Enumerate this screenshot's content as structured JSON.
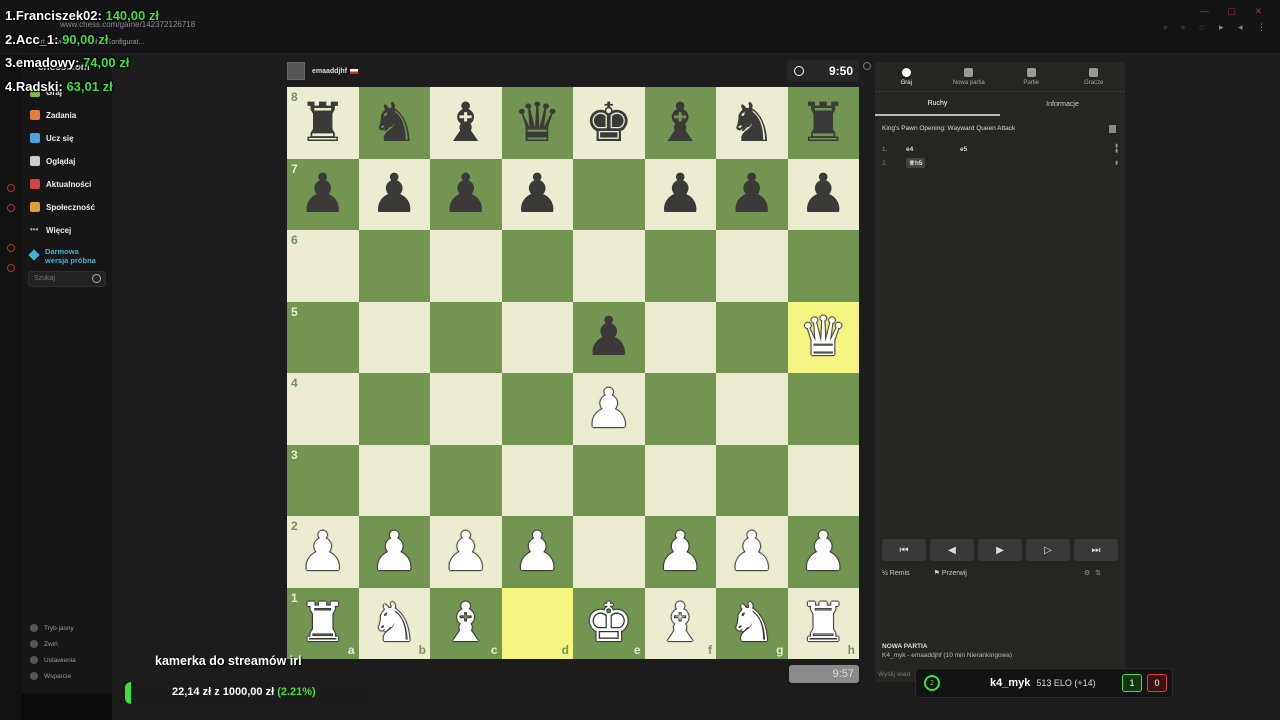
{
  "browser": {
    "url": "www.chess.com/game/142372126718",
    "bookmarks": [
      "Start - Twitch",
      "Tipply | Konfigurat..."
    ]
  },
  "sidebar": {
    "logo": "chess.com",
    "items": [
      {
        "label": "Graj",
        "icon": "pawn-icon",
        "color": "#81b64c"
      },
      {
        "label": "Zadania",
        "icon": "puzzle-icon",
        "color": "#e77c3a"
      },
      {
        "label": "Ucz się",
        "icon": "learn-icon",
        "color": "#4aa3df"
      },
      {
        "label": "Oglądaj",
        "icon": "binoculars-icon",
        "color": "#cccccc"
      },
      {
        "label": "Aktualności",
        "icon": "news-icon",
        "color": "#d04545"
      },
      {
        "label": "Społeczność",
        "icon": "community-icon",
        "color": "#e0a030"
      },
      {
        "label": "Więcej",
        "icon": "more-icon",
        "color": "#aaaaaa"
      }
    ],
    "trial_line1": "Darmowa",
    "trial_line2": "wersja próbna",
    "search_placeholder": "Szukaj",
    "bottom": [
      "Tryb jasny",
      "Zwiń",
      "Ustawienia",
      "Wsparcie"
    ]
  },
  "top_player": {
    "name": "emaaddjhf"
  },
  "clock_top": "9:50",
  "clock_bottom": "9:57",
  "board": {
    "ranks": [
      "8",
      "7",
      "6",
      "5",
      "4",
      "3",
      "2",
      "1"
    ],
    "files": [
      "a",
      "b",
      "c",
      "d",
      "e",
      "f",
      "g",
      "h"
    ],
    "position": [
      [
        "br",
        "bn",
        "bb",
        "bq",
        "bk",
        "bb",
        "bn",
        "br"
      ],
      [
        "bp",
        "bp",
        "bp",
        "bp",
        "",
        "bp",
        "bp",
        "bp"
      ],
      [
        "",
        "",
        "",
        "",
        "",
        "",
        "",
        ""
      ],
      [
        "",
        "",
        "",
        "",
        "bp",
        "",
        "",
        "wq"
      ],
      [
        "",
        "",
        "",
        "",
        "wp",
        "",
        "",
        ""
      ],
      [
        "",
        "",
        "",
        "",
        "",
        "",
        "",
        ""
      ],
      [
        "wp",
        "wp",
        "wp",
        "wp",
        "",
        "wp",
        "wp",
        "wp"
      ],
      [
        "wr",
        "wn",
        "wb",
        "",
        "wk",
        "wb",
        "wn",
        "wr"
      ]
    ],
    "highlights": [
      "d1",
      "h5"
    ]
  },
  "panel": {
    "tabs": [
      {
        "label": "Graj",
        "icon": "clock-icon"
      },
      {
        "label": "Nowa partia",
        "icon": "plus-icon"
      },
      {
        "label": "Partie",
        "icon": "board-icon"
      },
      {
        "label": "Gracze",
        "icon": "users-icon"
      }
    ],
    "sub_tabs": [
      "Ruchy",
      "Informacje"
    ],
    "opening": "King's Pawn Opening: Wayward Queen Attack",
    "moves": [
      {
        "num": "1.",
        "white": "e4",
        "black": "e5"
      },
      {
        "num": "2.",
        "white": "♕h5",
        "black": ""
      }
    ],
    "actions": {
      "draw": "Remis",
      "abort": "Przerwij"
    },
    "new_game_title": "NOWA PARTIA",
    "new_game_desc": "K4_myk - emaaddjhf (10 min Nierankingowa)",
    "chat_placeholder": "Wyślij wiad"
  },
  "overlay": {
    "donations": [
      {
        "rank": "1.",
        "name": "Franciszek02:",
        "amount": "140,00 zł"
      },
      {
        "rank": "2.",
        "name": "Acc_1:",
        "amount": "90,00 zł"
      },
      {
        "rank": "3.",
        "name": "emadowy:",
        "amount": "74,00 zł"
      },
      {
        "rank": "4.",
        "name": "Radski:",
        "amount": "63,01 zł"
      }
    ],
    "cam_title": "kamerka do streamów irl",
    "goal_current": "22,14 zł",
    "goal_sep": "z",
    "goal_target": "1000,00 zł",
    "goal_pct_label": "(2.21%)",
    "goal_fraction": 0.0221,
    "elo_name": "k4_myk",
    "elo_rating": "513 ELO (+14)",
    "elo_icon_label": "2",
    "wins": "1",
    "losses": "0"
  },
  "colors": {
    "light_square": "#ebecd0",
    "dark_square": "#739552",
    "highlight": "#f5f682",
    "accent_green": "#3ee03e"
  }
}
